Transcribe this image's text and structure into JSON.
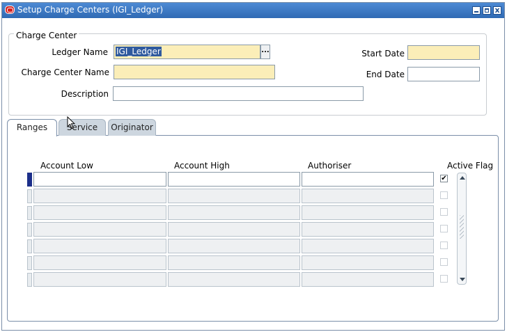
{
  "window": {
    "title": "Setup Charge Centers (IGI_Ledger)",
    "close_glyph": "x"
  },
  "charge_center": {
    "legend": "Charge Center",
    "ledger_name_label": "Ledger Name",
    "ledger_name_value": "IGI_Ledger",
    "lov_glyph": "...",
    "charge_center_name_label": "Charge Center Name",
    "charge_center_name_value": "",
    "description_label": "Description",
    "description_value": "",
    "start_date_label": "Start Date",
    "start_date_value": "",
    "end_date_label": "End Date",
    "end_date_value": ""
  },
  "tabs": [
    {
      "label": "Ranges",
      "active": true
    },
    {
      "label": "Service",
      "active": false
    },
    {
      "label": "Originator",
      "active": false
    }
  ],
  "ranges_table": {
    "columns": [
      "Account Low",
      "Account High",
      "Authoriser",
      "Active Flag"
    ],
    "rows": [
      {
        "account_low": "",
        "account_high": "",
        "authoriser": "",
        "active_flag": true,
        "current": true
      },
      {
        "account_low": "",
        "account_high": "",
        "authoriser": "",
        "active_flag": false,
        "current": false
      },
      {
        "account_low": "",
        "account_high": "",
        "authoriser": "",
        "active_flag": false,
        "current": false
      },
      {
        "account_low": "",
        "account_high": "",
        "authoriser": "",
        "active_flag": false,
        "current": false
      },
      {
        "account_low": "",
        "account_high": "",
        "authoriser": "",
        "active_flag": false,
        "current": false
      },
      {
        "account_low": "",
        "account_high": "",
        "authoriser": "",
        "active_flag": false,
        "current": false
      },
      {
        "account_low": "",
        "account_high": "",
        "authoriser": "",
        "active_flag": false,
        "current": false
      }
    ],
    "check_glyph": "✔"
  },
  "colors": {
    "titlebar": "#3b78c4",
    "required_field": "#fbeeb8",
    "selection": "#2f5a9e",
    "current_record": "#1c2f8a"
  }
}
